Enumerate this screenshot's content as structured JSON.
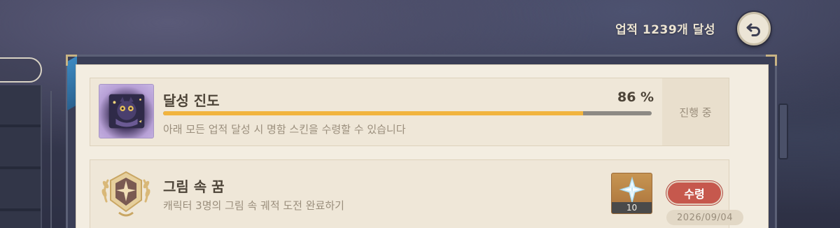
{
  "header": {
    "achievement_count": "업적 1239개 달성",
    "back_icon": "back-arrow-icon"
  },
  "progress_card": {
    "title": "달성 진도",
    "percent_label": "86 %",
    "progress": 0.86,
    "description": "아래 모든 업적 달성 시 명함 스킨을 수령할 수 있습니다",
    "status": "진행 중",
    "thumbnail_icon": "namecard-skin-icon",
    "colors": {
      "fill": "#f1b43e",
      "track": "#8d8a84"
    }
  },
  "achievement_card": {
    "title": "그림 속 꿈",
    "description": "캐릭터 3명의 그림 속 궤적 도전 완료하기",
    "badge_icon": "achievement-badge-icon",
    "reward_icon": "primogem-icon",
    "reward_qty": "10",
    "claim_label": "수령",
    "date": "2026/09/04",
    "colors": {
      "claim": "#c6584d"
    }
  }
}
